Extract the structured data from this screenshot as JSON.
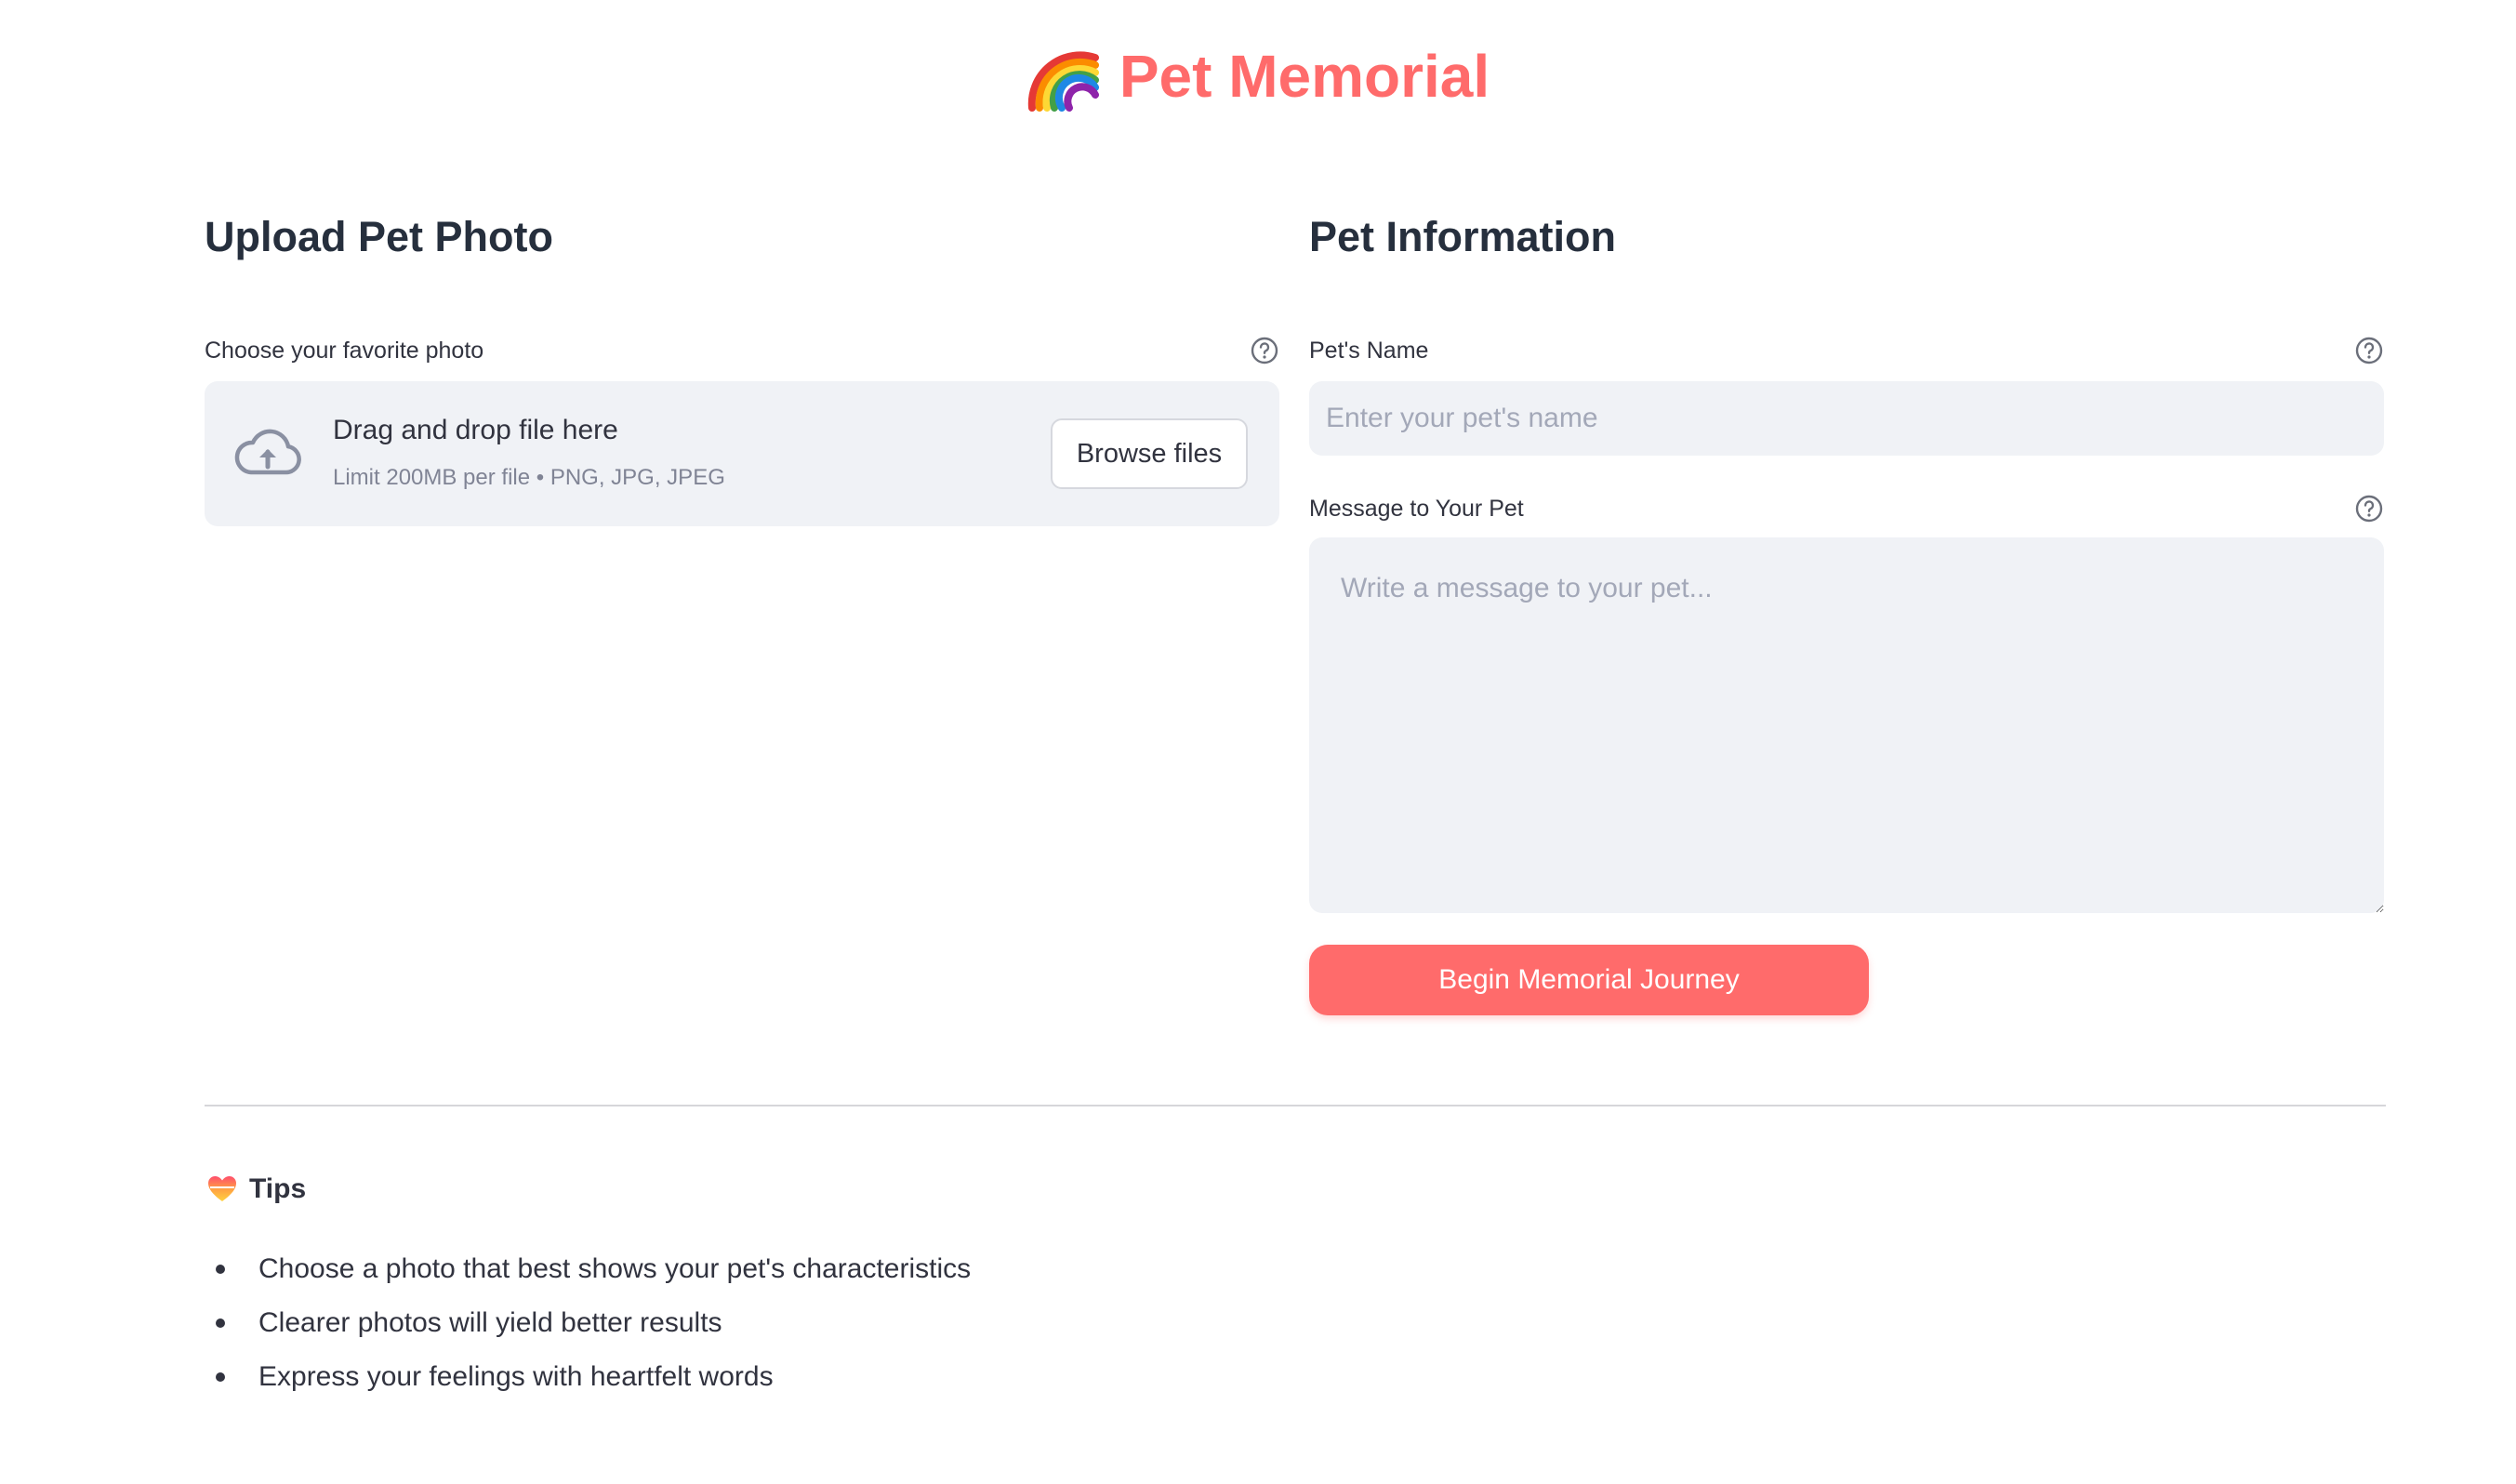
{
  "app": {
    "title": "Pet Memorial",
    "title_icon": "rainbow-icon",
    "accent_color": "#ff6b6b"
  },
  "upload": {
    "heading": "Upload Pet Photo",
    "label": "Choose your favorite photo",
    "help_icon": "help-circle-icon",
    "dropzone_icon": "cloud-upload-icon",
    "dropzone_text": "Drag and drop file here",
    "dropzone_limit": "Limit 200MB per file • PNG, JPG, JPEG",
    "browse_label": "Browse files"
  },
  "info": {
    "heading": "Pet Information",
    "name_label": "Pet's Name",
    "name_placeholder": "Enter your pet's name",
    "name_value": "",
    "message_label": "Message to Your Pet",
    "message_placeholder": "Write a message to your pet...",
    "message_value": "",
    "submit_label": "Begin Memorial Journey"
  },
  "tips": {
    "icon": "heart-icon",
    "heading": "Tips",
    "items": [
      "Choose a photo that best shows your pet's characteristics",
      "Clearer photos will yield better results",
      "Express your feelings with heartfelt words"
    ]
  }
}
